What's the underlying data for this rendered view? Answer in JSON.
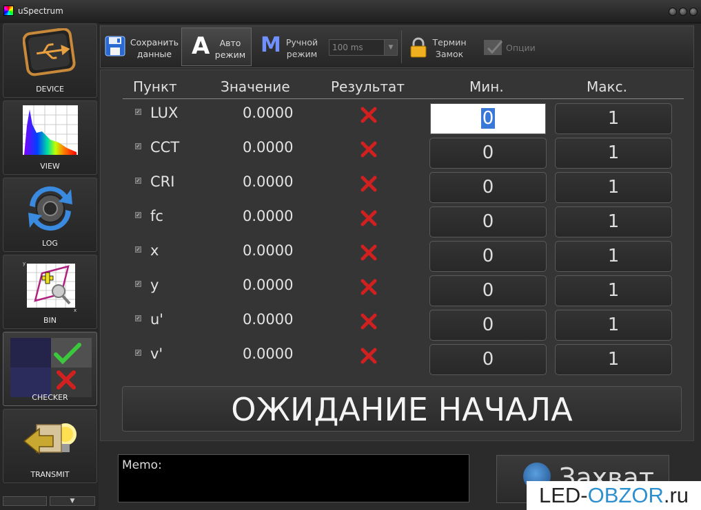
{
  "window": {
    "title": "uSpectrum"
  },
  "sidebar": {
    "items": [
      {
        "label": "DEVICE"
      },
      {
        "label": "VIEW"
      },
      {
        "label": "LOG"
      },
      {
        "label": "BIN"
      },
      {
        "label": "CHECKER"
      },
      {
        "label": "TRANSMIT"
      }
    ],
    "scroll_down_glyph": "▼"
  },
  "toolbar": {
    "save": {
      "line1": "Сохранить",
      "line2": "данные"
    },
    "auto": {
      "glyph": "A",
      "line1": "Авто",
      "line2": "режим"
    },
    "manual": {
      "glyph": "M",
      "line1": "Ручной",
      "line2": "режим"
    },
    "interval": {
      "value": "100 ms"
    },
    "terminal_lock": {
      "line1": "Термин",
      "line2": "Замок"
    },
    "options": {
      "label": "Опции"
    }
  },
  "table": {
    "headers": {
      "item": "Пункт",
      "value": "Значение",
      "result": "Результат",
      "min": "Мин.",
      "max": "Макс."
    },
    "rows": [
      {
        "name": "LUX",
        "value": "0.0000",
        "min": "0",
        "max": "1"
      },
      {
        "name": "CCT",
        "value": "0.0000",
        "min": "0",
        "max": "1"
      },
      {
        "name": "CRI",
        "value": "0.0000",
        "min": "0",
        "max": "1"
      },
      {
        "name": "fc",
        "value": "0.0000",
        "min": "0",
        "max": "1"
      },
      {
        "name": "x",
        "value": "0.0000",
        "min": "0",
        "max": "1"
      },
      {
        "name": "y",
        "value": "0.0000",
        "min": "0",
        "max": "1"
      },
      {
        "name": "u'",
        "value": "0.0000",
        "min": "0",
        "max": "1"
      },
      {
        "name": "v'",
        "value": "0.0000",
        "min": "0",
        "max": "1"
      }
    ]
  },
  "status": {
    "text": "ОЖИДАНИЕ НАЧАЛА"
  },
  "memo": {
    "label": "Memo:"
  },
  "capture": {
    "label": "Захват"
  },
  "watermark": {
    "part1": "LED-",
    "part2": "OBZOR",
    "part3": ".ru"
  },
  "colors": {
    "fail_mark": "#d02020",
    "pass_mark": "#3cc83c",
    "accent_blue": "#3a78d8"
  }
}
